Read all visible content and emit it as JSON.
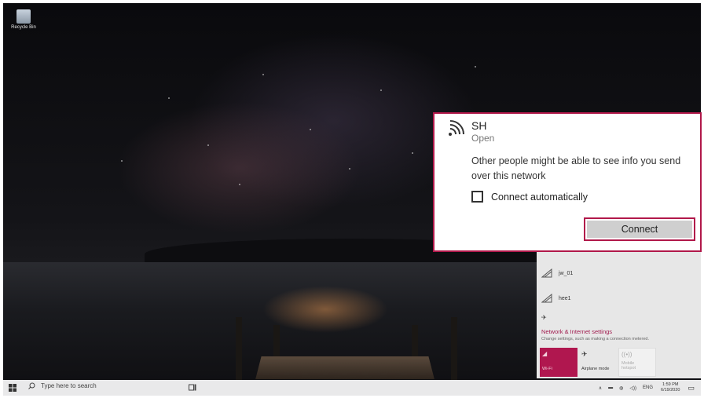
{
  "desktop": {
    "recycle_bin_label": "Recycle Bin"
  },
  "popup": {
    "ssid": "SH",
    "status": "Open",
    "warning": "Other people might be able to see info you send over this network",
    "auto_connect_label": "Connect automatically",
    "auto_connect_checked": false,
    "connect_label": "Connect",
    "highlight_color": "#b1184a"
  },
  "network_list": [
    {
      "name": "jw_01"
    },
    {
      "name": "hee1"
    }
  ],
  "flyout": {
    "settings_link": "Network & Internet settings",
    "settings_sub": "Change settings, such as making a connection metered.",
    "quick_actions": [
      {
        "label": "Wi-Fi",
        "active": true
      },
      {
        "label": "Airplane mode",
        "active": false
      },
      {
        "label": "Mobile hotspot",
        "active": false
      }
    ],
    "accent_color": "#b0174f"
  },
  "taskbar": {
    "search_placeholder": "Type here to search",
    "language": "ENG",
    "time": "1:59 PM",
    "date": "6/19/2020"
  }
}
